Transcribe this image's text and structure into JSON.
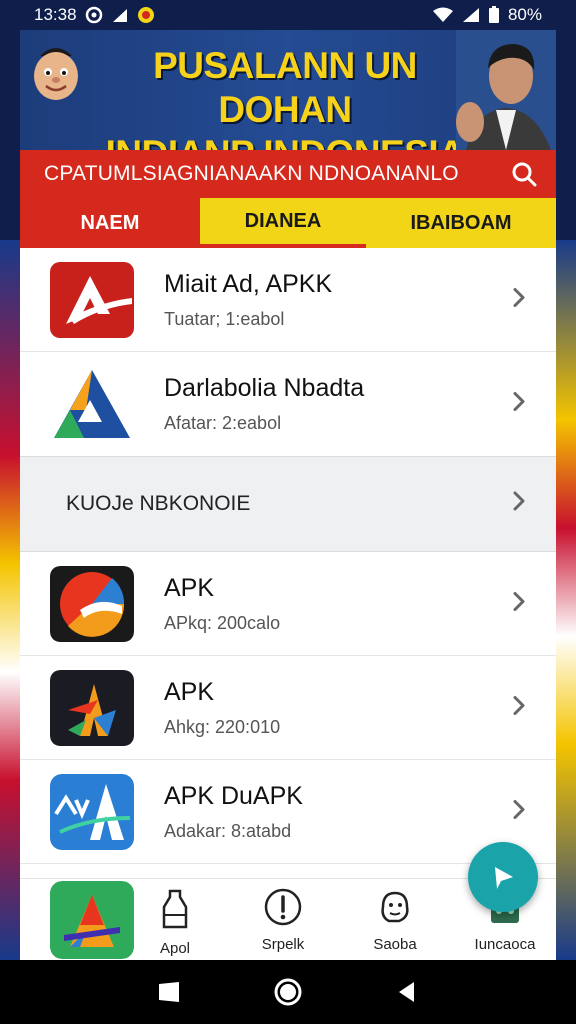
{
  "status_bar": {
    "time": "13:38",
    "battery": "80%"
  },
  "banner": {
    "title_line1": "PUSALANN UN DOHAN",
    "title_line2": "INDIANP INDONESIA"
  },
  "search": {
    "text": "CPATUMLSIAGNIANAAKN NDNOANANLO"
  },
  "tabs": [
    {
      "label": "NAEM"
    },
    {
      "label": "DIANEA"
    },
    {
      "label": "IBAIBOAM"
    }
  ],
  "apps_top": [
    {
      "title": "Miait Ad, APKK",
      "subtitle": "Tuatar; 1:eabol",
      "icon": "red-arrow-icon"
    },
    {
      "title": "Darlabolia Nbadta",
      "subtitle": "Afatar: 2:eabol",
      "icon": "triangle-arrow-icon"
    }
  ],
  "section": {
    "label": "KUOJe NBKONOIE"
  },
  "apps_bottom": [
    {
      "title": "APK",
      "subtitle": "APkq: 200calo",
      "icon": "circle-swirl-icon"
    },
    {
      "title": "APK",
      "subtitle": "Ahkg: 220:010",
      "icon": "colorful-a-icon"
    },
    {
      "title": "APK DuAPK",
      "subtitle": "Adakar: 8:atabd",
      "icon": "blue-av-icon"
    }
  ],
  "bottom_nav": [
    {
      "label": "Apol",
      "icon": "bottle-icon"
    },
    {
      "label": "Srpelk",
      "icon": "exclamation-icon"
    },
    {
      "label": "Saoba",
      "icon": "face-icon"
    },
    {
      "label": "Iuncaoca",
      "icon": "robot-icon"
    }
  ],
  "colors": {
    "red": "#d4291c",
    "yellow": "#f1d516",
    "navy": "#1d3c7a",
    "fab": "#1aa3a8"
  }
}
